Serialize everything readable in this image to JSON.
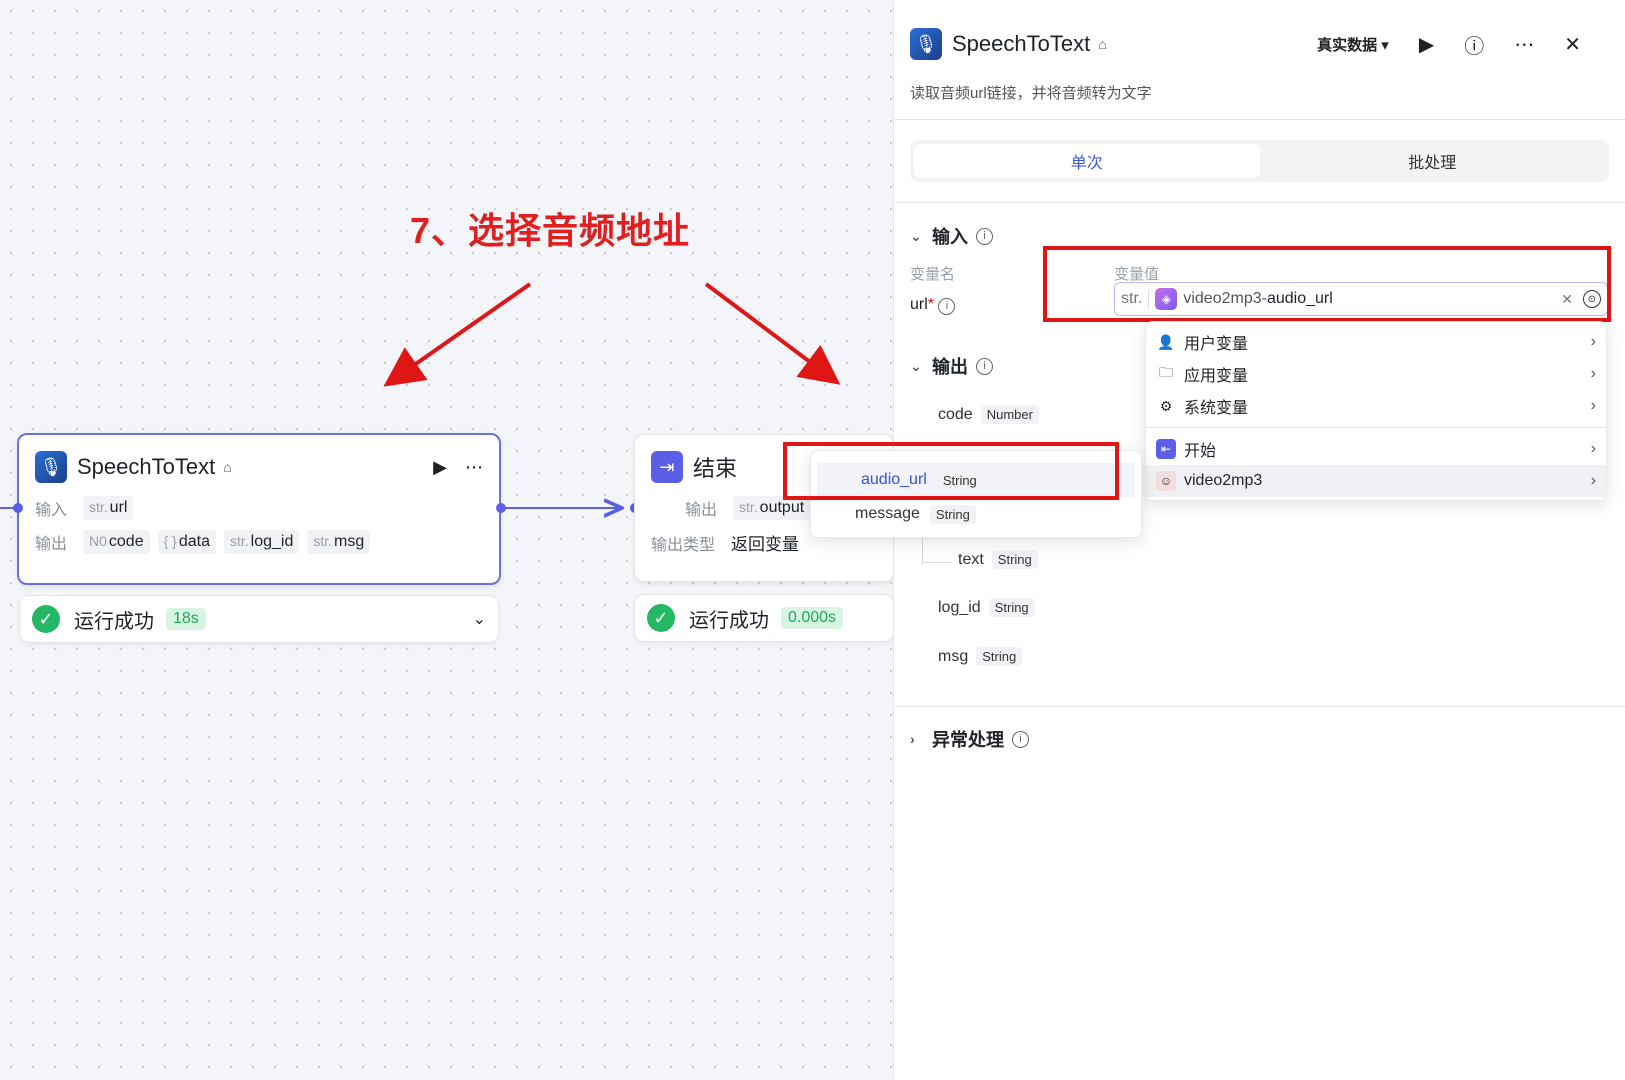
{
  "annotation": {
    "text": "7、选择音频地址"
  },
  "stt_node": {
    "title": "SpeechToText",
    "input_label": "输入",
    "input_tag": {
      "prefix": "str.",
      "name": "url"
    },
    "output_label": "输出",
    "outputs": [
      {
        "prefix": "N0",
        "name": "code"
      },
      {
        "prefix": "{ }",
        "name": "data"
      },
      {
        "prefix": "str.",
        "name": "log_id"
      },
      {
        "prefix": "str.",
        "name": "msg"
      }
    ],
    "status_text": "运行成功",
    "status_time": "18s"
  },
  "end_node": {
    "title": "结束",
    "output_label": "输出",
    "output_tag": {
      "prefix": "str.",
      "name": "output"
    },
    "output_type_label": "输出类型",
    "output_type_value": "返回变量",
    "status_text": "运行成功",
    "status_time": "0.000s"
  },
  "field_popup": {
    "items": [
      {
        "name": "audio_url",
        "type": "String"
      },
      {
        "name": "message",
        "type": "String"
      }
    ]
  },
  "panel": {
    "title": "SpeechToText",
    "mode_select": "真实数据",
    "description": "读取音频url链接，并将音频转为文字",
    "tabs": [
      "单次",
      "批处理"
    ],
    "input_section": "输入",
    "col_var_name": "变量名",
    "col_var_value": "变量值",
    "url_label": "url",
    "url_required": "*",
    "url_prefix": "str.",
    "url_value_node": "video2mp3",
    "url_value_sep": " - ",
    "url_value_field": "audio_url",
    "output_section": "输出",
    "outputs": [
      {
        "name": "code",
        "type": "Number"
      },
      {
        "name": "text",
        "type": "String"
      },
      {
        "name": "log_id",
        "type": "String"
      },
      {
        "name": "msg",
        "type": "String"
      }
    ],
    "exception_section": "异常处理"
  },
  "var_menu": {
    "items": [
      "用户变量",
      "应用变量",
      "系统变量",
      "开始",
      "video2mp3"
    ]
  },
  "colors": {
    "accent": "#5b5fe8",
    "annotation_red": "#e01616",
    "success": "#25b864"
  }
}
